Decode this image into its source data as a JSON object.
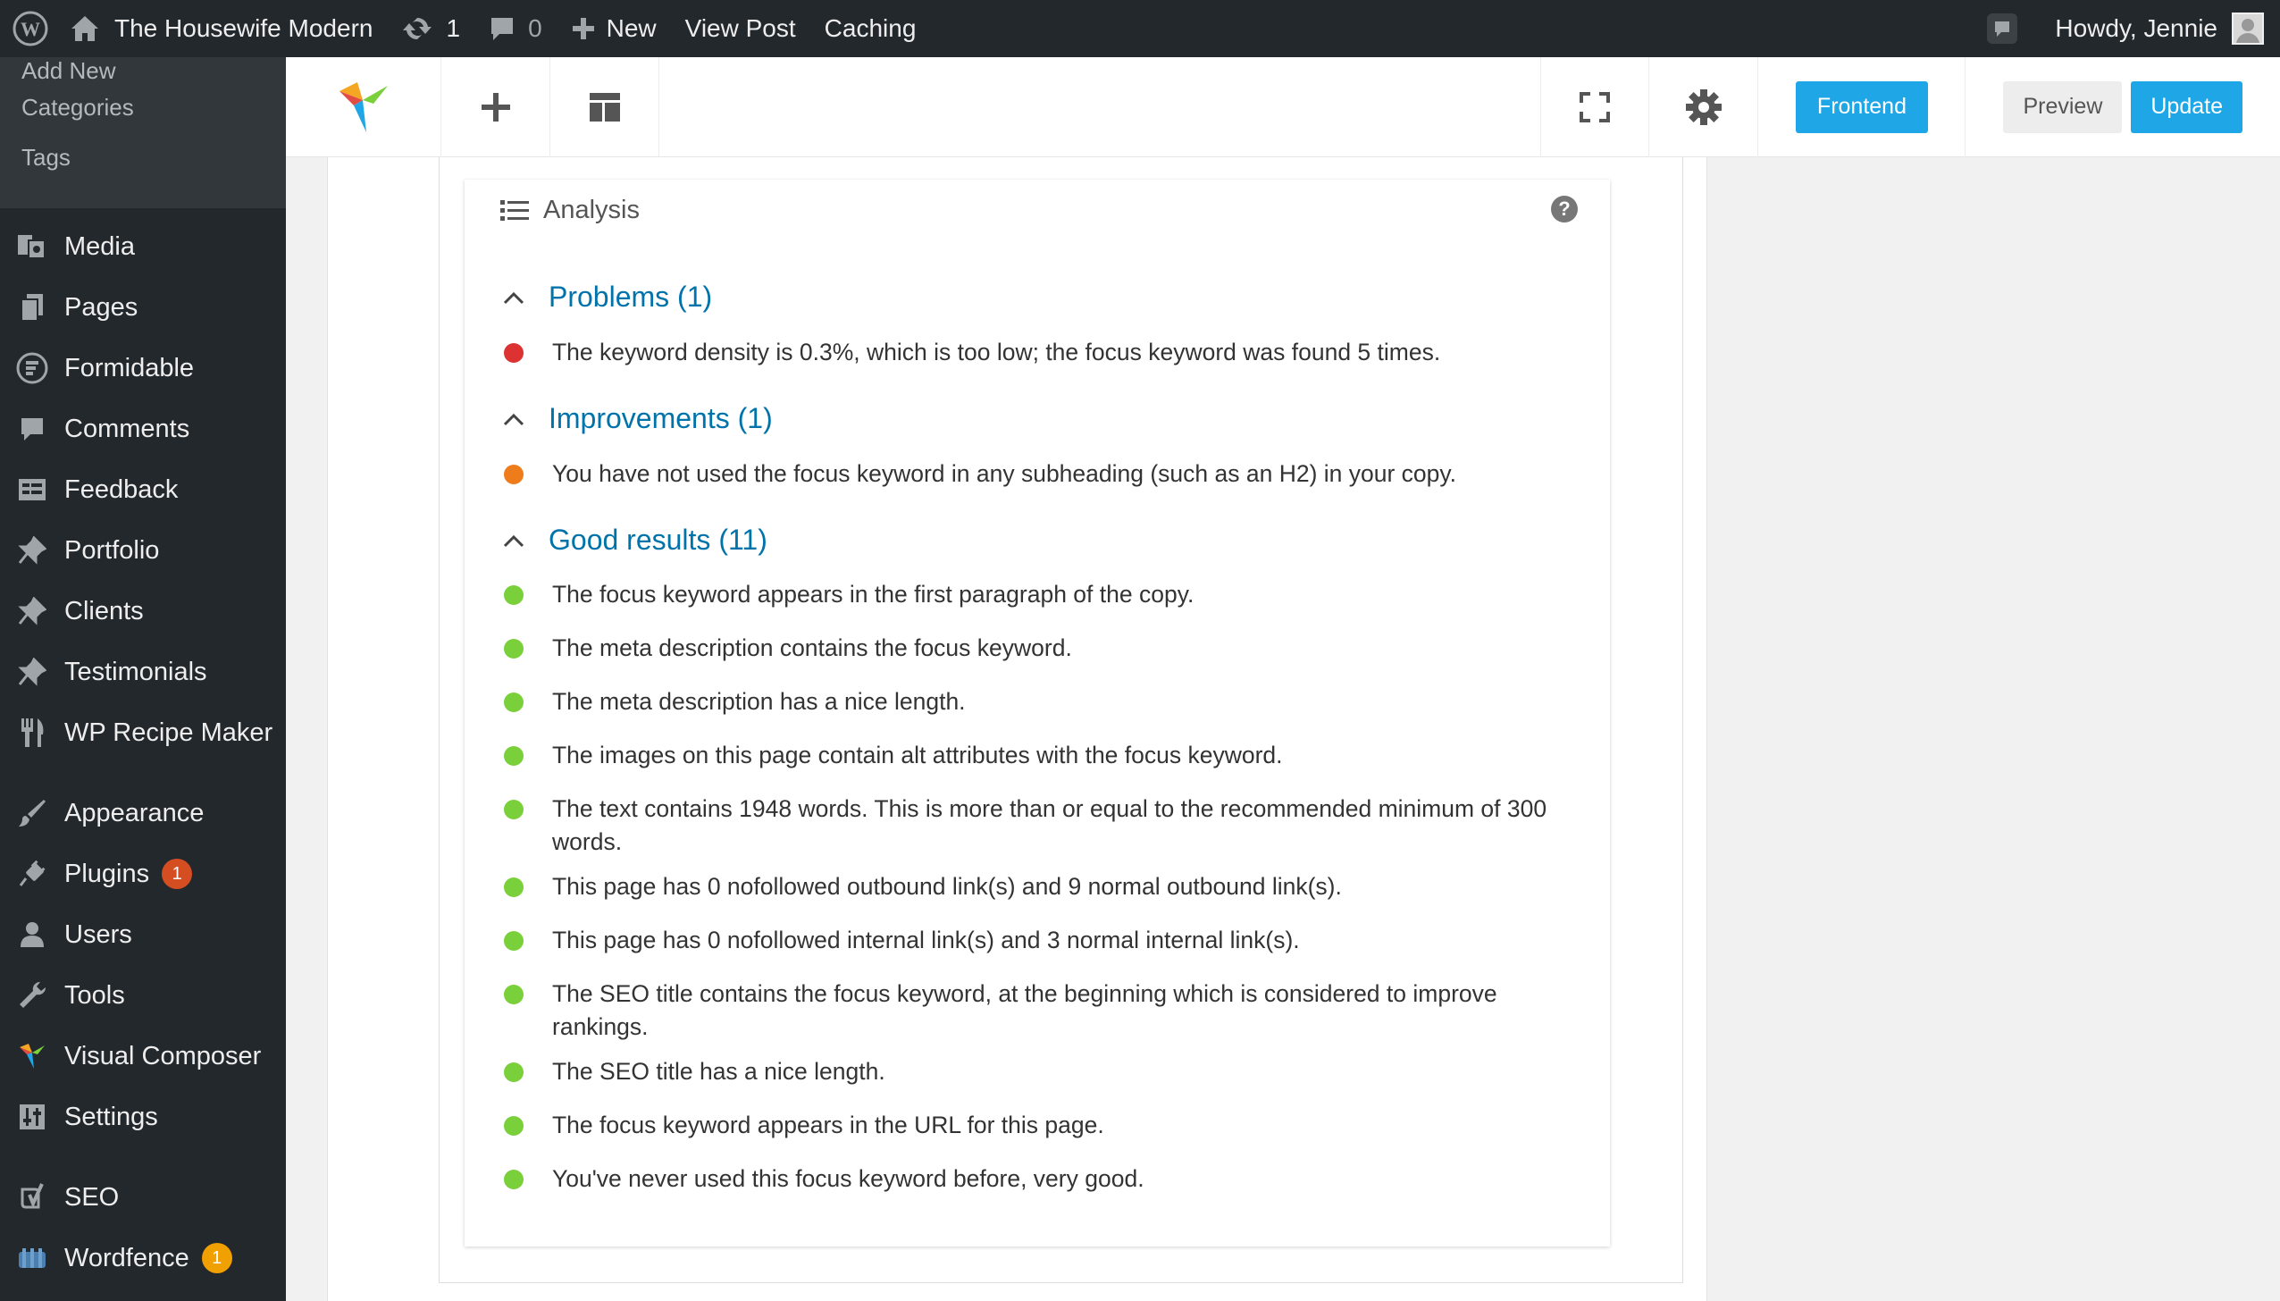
{
  "adminbar": {
    "site_name": "The Housewife Modern",
    "updates_count": "1",
    "comments_count": "0",
    "new_label": "New",
    "view_post_label": "View Post",
    "caching_label": "Caching",
    "howdy": "Howdy, Jennie"
  },
  "sidebar": {
    "submenu": [
      "Add New",
      "Categories",
      "Tags"
    ],
    "items": [
      {
        "label": "Media",
        "icon": "media-icon"
      },
      {
        "label": "Pages",
        "icon": "pages-icon"
      },
      {
        "label": "Formidable",
        "icon": "formidable-icon"
      },
      {
        "label": "Comments",
        "icon": "comments-icon"
      },
      {
        "label": "Feedback",
        "icon": "feedback-icon"
      },
      {
        "label": "Portfolio",
        "icon": "pin-icon"
      },
      {
        "label": "Clients",
        "icon": "pin-icon"
      },
      {
        "label": "Testimonials",
        "icon": "pin-icon"
      },
      {
        "label": "WP Recipe Maker",
        "icon": "fork-knife-icon"
      },
      {
        "label": "Appearance",
        "icon": "brush-icon"
      },
      {
        "label": "Plugins",
        "icon": "plugin-icon",
        "badge": "1"
      },
      {
        "label": "Users",
        "icon": "user-icon"
      },
      {
        "label": "Tools",
        "icon": "wrench-icon"
      },
      {
        "label": "Visual Composer",
        "icon": "vc-logo-icon"
      },
      {
        "label": "Settings",
        "icon": "sliders-icon"
      },
      {
        "label": "SEO",
        "icon": "yoast-icon"
      },
      {
        "label": "Wordfence",
        "icon": "wordfence-icon",
        "badge": "1"
      }
    ]
  },
  "toolbar": {
    "frontend_label": "Frontend",
    "preview_label": "Preview",
    "update_label": "Update"
  },
  "analysis": {
    "title": "Analysis",
    "help": "?",
    "problems": {
      "heading": "Problems (1)",
      "items": [
        "The keyword density is 0.3%, which is too low; the focus keyword was found 5 times."
      ]
    },
    "improvements": {
      "heading": "Improvements (1)",
      "items": [
        "You have not used the focus keyword in any subheading (such as an H2) in your copy."
      ]
    },
    "good": {
      "heading": "Good results (11)",
      "items": [
        "The focus keyword appears in the first paragraph of the copy.",
        "The meta description contains the focus keyword.",
        "The meta description has a nice length.",
        "The images on this page contain alt attributes with the focus keyword.",
        "The text contains 1948 words. This is more than or equal to the recommended minimum of 300 words.",
        "This page has 0 nofollowed outbound link(s) and 9 normal outbound link(s).",
        "This page has 0 nofollowed internal link(s) and 3 normal internal link(s).",
        "The SEO title contains the focus keyword, at the beginning which is considered to improve rankings.",
        "The SEO title has a nice length.",
        "The focus keyword appears in the URL for this page.",
        "You've never used this focus keyword before, very good."
      ]
    }
  },
  "colors": {
    "adminbar_bg": "#23282d",
    "accent_blue": "#1fa6e6",
    "link_blue": "#0073aa",
    "problem_red": "#dc3232",
    "improvement_orange": "#ee7c1b",
    "good_green": "#7ad03a",
    "plugins_badge": "#d54e21",
    "wordfence_badge": "#f0a000"
  }
}
